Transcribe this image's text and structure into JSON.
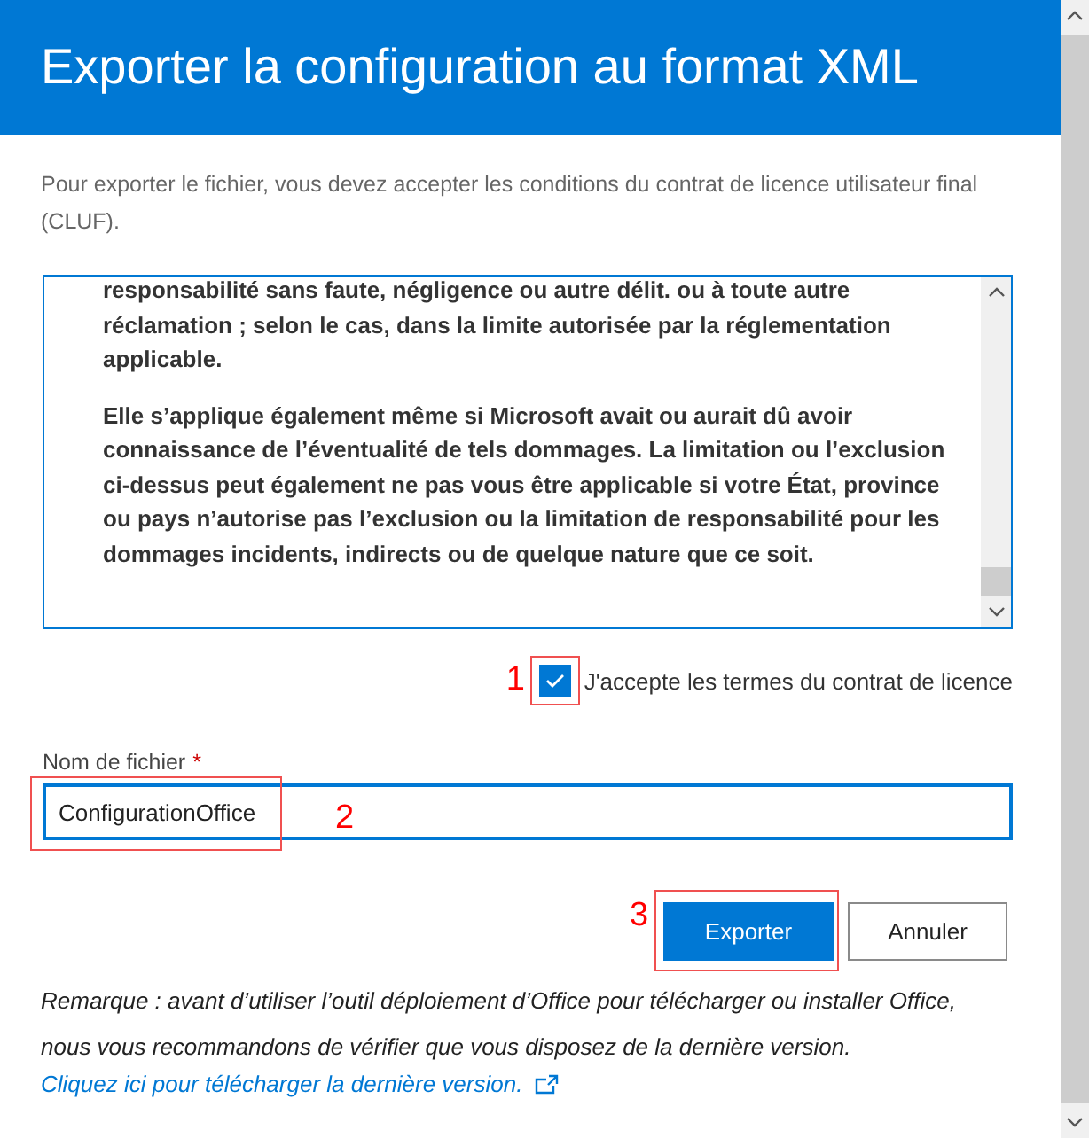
{
  "dialog": {
    "title": "Exporter la configuration au format XML",
    "intro": "Pour exporter le fichier, vous devez accepter les conditions du contrat de licence utilisateur final (CLUF).",
    "license_paragraphs": [
      "responsabilité sans faute, négligence ou autre délit. ou à toute autre réclamation ; selon le cas, dans la limite autorisée par la réglementation applicable.",
      "Elle s’applique également même si Microsoft avait ou aurait dû avoir connaissance de l’éventualité de tels dommages. La limitation ou l’exclusion ci-dessus peut également ne pas vous être applicable si votre État, province ou pays n’autorise pas l’exclusion ou la limitation de responsabilité pour les dommages incidents, indirects ou de quelque nature que ce soit."
    ],
    "accept": {
      "label": "J'accepte les termes du contrat de licence",
      "checked": true
    },
    "file_name": {
      "label": "Nom de fichier",
      "required_mark": "*",
      "value": "ConfigurationOffice"
    },
    "buttons": [
      {
        "label": "Exporter",
        "kind": "primary"
      },
      {
        "label": "Annuler",
        "kind": "secondary"
      }
    ],
    "note": "Remarque : avant d’utiliser l’outil déploiement d’Office pour télécharger ou installer Office, nous vous recommandons de vérifier que vous disposez de la dernière version.",
    "link": "Cliquez ici pour télécharger la dernière version."
  },
  "annotations": [
    {
      "label": "1"
    },
    {
      "label": "2"
    },
    {
      "label": "3"
    }
  ]
}
